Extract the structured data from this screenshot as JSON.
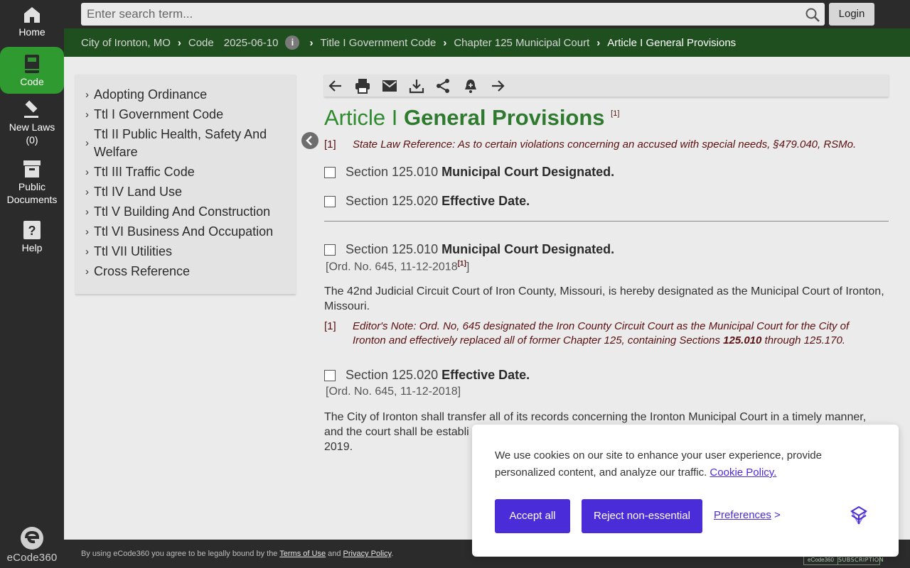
{
  "rail": {
    "home": "Home",
    "code": "Code",
    "new_laws": "New Laws",
    "new_laws_count": "(0)",
    "public_documents_line1": "Public",
    "public_documents_line2": "Documents",
    "help": "Help",
    "logo": "eCode360"
  },
  "search": {
    "placeholder": "Enter search term..."
  },
  "login": "Login",
  "breadcrumb": {
    "city": "City of Ironton, MO",
    "code": "Code",
    "date": "2025-06-10",
    "info": "i",
    "title": "Title I Government Code",
    "chapter": "Chapter 125 Municipal Court",
    "article": "Article I General Provisions"
  },
  "toc": {
    "items": [
      "Adopting Ordinance",
      "Ttl I Government Code",
      "Ttl II Public Health, Safety And Welfare",
      "Ttl III Traffic Code",
      "Ttl IV Land Use",
      "Ttl V Building And Construction",
      "Ttl VI Business And Occupation",
      "Ttl VII Utilities",
      "Cross Reference"
    ]
  },
  "toolbar": {
    "icons": [
      "back-arrow-icon",
      "print-icon",
      "email-icon",
      "download-icon",
      "share-icon",
      "notification-bell-icon",
      "forward-arrow-icon"
    ]
  },
  "article": {
    "prefix": "Article I",
    "name": "General Provisions",
    "footnote_marker": "[1]",
    "footnote_num": "[1]",
    "footnote_text": "State Law Reference: As to certain violations concerning an accused with special needs, §479.040, RSMo."
  },
  "toc_sections": [
    {
      "number": "Section 125.010",
      "title": "Municipal Court Designated."
    },
    {
      "number": "Section 125.020",
      "title": "Effective Date."
    }
  ],
  "sections": [
    {
      "number": "Section 125.010",
      "title": "Municipal Court Designated.",
      "history_open": "[Ord. No. 645, 11-12-2018",
      "history_sup": "[1]",
      "history_close": "]",
      "body": "The 42nd Judicial Circuit Court of Iron County, Missouri, is hereby designated as the Municipal Court of Ironton, Missouri.",
      "note_num": "[1]",
      "note_text_1": "Editor's Note: Ord. No, 645 designated the Iron County Circuit Court as the Municipal Court for the City of Ironton and effectively replaced all of former Chapter 125, containing Sections ",
      "note_bold": "125.010",
      "note_text_2": " through 125.170."
    },
    {
      "number": "Section 125.020",
      "title": "Effective Date.",
      "history": "[Ord. No. 645, 11-12-2018]",
      "body_line1": "The City of Ironton shall transfer all of its records concerning the Ironton Municipal Court in a timely manner,",
      "body_line2": "and the court shall be establi",
      "body_line3": "2019."
    }
  ],
  "footer": {
    "text_before": "By using eCode360 you agree to be legally bound by the ",
    "terms": "Terms of Use",
    "and": " and ",
    "privacy": "Privacy Policy",
    "end": ".",
    "badge_left": "eCode360",
    "badge_right": "SUBSCRIPTION"
  },
  "cookie": {
    "text": "We use cookies on our site to enhance your user experience, provide personalized content, and analyze our traffic. ",
    "policy_link": "Cookie Policy.",
    "accept": "Accept all",
    "reject": "Reject non-essential",
    "preferences": "Preferences",
    "preferences_arrow": " >"
  },
  "colors": {
    "rail_bg": "#2b2b2b",
    "active_green": "#2f9a2f",
    "breadcrumb_green": "#1f4f1f",
    "title_green": "#2e8a2e",
    "footnote_red": "#5a1010",
    "cookie_purple": "#4a2cd8"
  }
}
